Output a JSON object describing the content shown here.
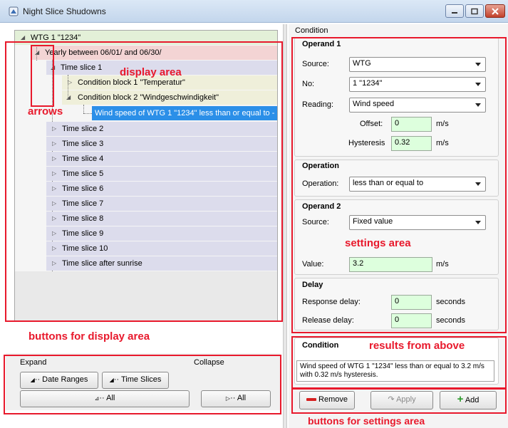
{
  "window": {
    "title": "Night Slice Shudowns"
  },
  "tree": {
    "root": "WTG 1 \"1234\"",
    "yearly": "Yearly between 06/01/ and 06/30/",
    "time_slice_1": "Time slice 1",
    "condition_block_1": "Condition block 1 \"Temperatur\"",
    "condition_block_2": "Condition block 2 \"Windgeschwindigkeit\"",
    "selected_condition": "Wind speed of WTG 1 \"1234\" less than or equal to -",
    "time_slices": [
      "Time slice 2",
      "Time slice 3",
      "Time slice 4",
      "Time slice 5",
      "Time slice 6",
      "Time slice 7",
      "Time slice 8",
      "Time slice 9",
      "Time slice 10",
      "Time slice after sunrise"
    ]
  },
  "bottom_left": {
    "expand_label": "Expand",
    "collapse_label": "Collapse",
    "date_ranges_button": "Date Ranges",
    "time_slices_button": "Time Slices",
    "expand_all_button": "All",
    "collapse_all_button": "All"
  },
  "settings": {
    "header": "Condition",
    "operand1": {
      "title": "Operand 1",
      "source_label": "Source:",
      "source_value": "WTG",
      "no_label": "No:",
      "no_value": "1 \"1234\"",
      "reading_label": "Reading:",
      "reading_value": "Wind speed",
      "offset_label": "Offset:",
      "offset_value": "0",
      "offset_unit": "m/s",
      "hysteresis_label": "Hysteresis",
      "hysteresis_value": "0.32",
      "hysteresis_unit": "m/s"
    },
    "operation": {
      "title": "Operation",
      "label": "Operation:",
      "value": "less than or equal to"
    },
    "operand2": {
      "title": "Operand 2",
      "source_label": "Source:",
      "source_value": "Fixed value",
      "value_label": "Value:",
      "value": "3.2",
      "unit": "m/s"
    },
    "delay": {
      "title": "Delay",
      "response_label": "Response delay:",
      "response_value": "0",
      "response_unit": "seconds",
      "release_label": "Release delay:",
      "release_value": "0",
      "release_unit": "seconds"
    },
    "condition_result": {
      "title": "Condition",
      "text": "Wind speed of WTG 1 \"1234\" less than or equal to 3.2 m/s with  0.32 m/s hysteresis."
    },
    "buttons": {
      "remove": "Remove",
      "apply": "Apply",
      "add": "Add"
    }
  },
  "annotations": {
    "display_area": "display area",
    "arrows": "arrows",
    "buttons_display": "buttons for display area",
    "settings_area": "settings area",
    "results": "results from above",
    "buttons_settings": "buttons for settings area"
  },
  "colors": {
    "annotation_red": "#e8192c",
    "root_row": "#e3f0d8",
    "yearly_row": "#f3d4d4",
    "slice_row": "#dcdcec",
    "block_row": "#efefda",
    "selected_row": "#2b8fe8",
    "numeric_field": "#ddffdd"
  }
}
